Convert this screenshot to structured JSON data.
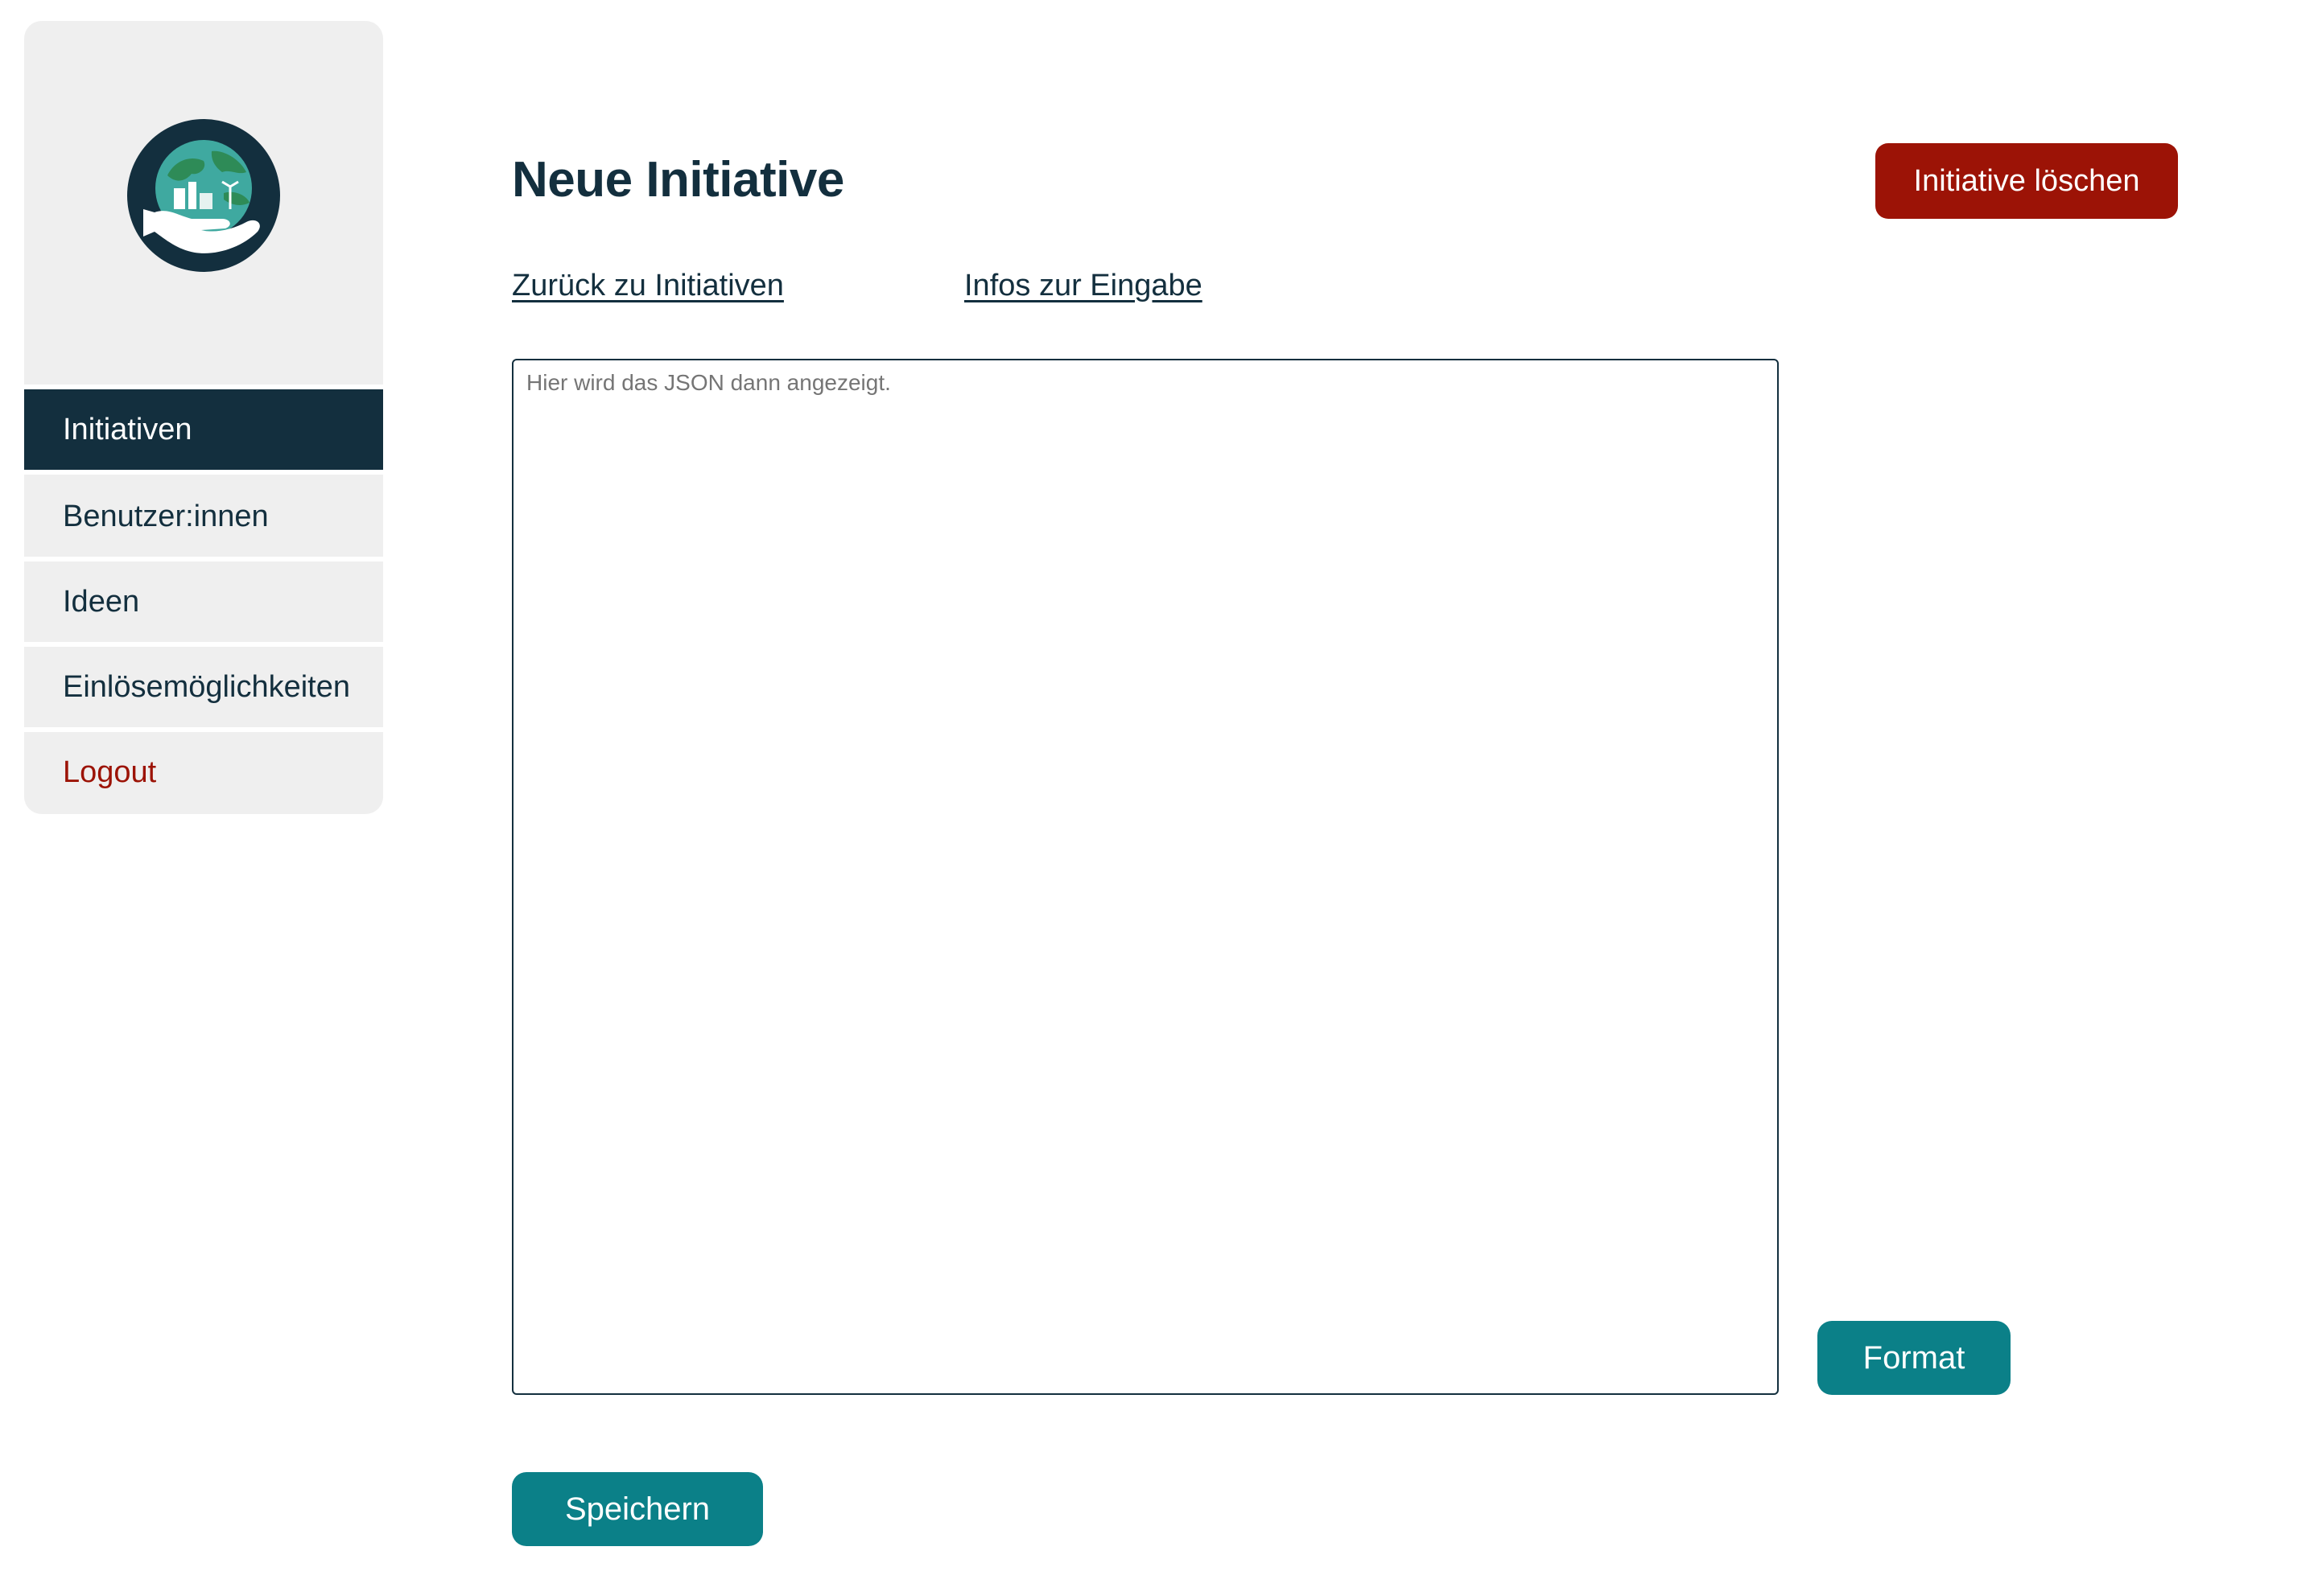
{
  "sidebar": {
    "logo_icon": "earth-in-hand-icon",
    "items": [
      {
        "label": "Initiativen",
        "active": true
      },
      {
        "label": "Benutzer:innen",
        "active": false
      },
      {
        "label": "Ideen",
        "active": false
      },
      {
        "label": "Einlösemöglichkeiten",
        "active": false
      },
      {
        "label": "Logout",
        "active": false
      }
    ]
  },
  "main": {
    "title": "Neue Initiative",
    "delete_label": "Initiative löschen",
    "links": {
      "back": "Zurück zu Initiativen",
      "info": "Infos zur Eingabe"
    },
    "json_editor": {
      "value": "",
      "placeholder": "Hier wird das JSON dann angezeigt."
    },
    "format_label": "Format",
    "save_label": "Speichern"
  },
  "colors": {
    "primary_dark": "#132f3e",
    "danger": "#9c1306",
    "accent_teal": "#0b8088",
    "sidebar_bg": "#efefef"
  }
}
